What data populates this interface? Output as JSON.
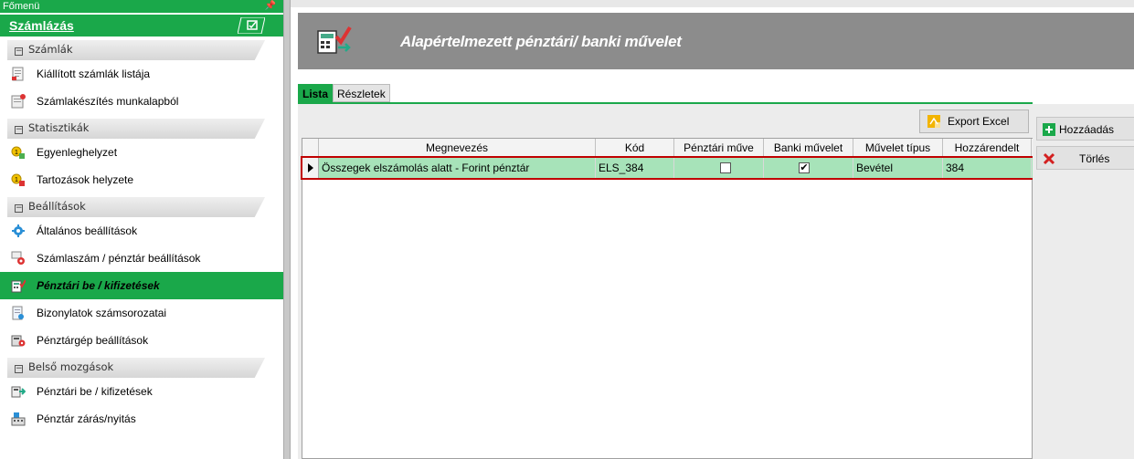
{
  "sidebar": {
    "title": "Főmenü",
    "pin": "ᵠ",
    "header": "Számlázás",
    "groups": {
      "szamlak": "Számlák",
      "statisztikak": "Statisztikák",
      "beallitasok": "Beállítások",
      "belso": "Belső mozgások"
    },
    "items": {
      "kiallitott": "Kiállított számlák listája",
      "munkalap": "Számlakészítés munkalapból",
      "egyenleg": "Egyenleghelyzet",
      "tartozasok": "Tartozások helyzete",
      "altalanos": "Általános beállítások",
      "szamlaszam": "Számlaszám / pénztár beállítások",
      "penztari": "Pénztári be / kifizetések",
      "bizonylatok": "Bizonylatok számsorozatai",
      "penztargep": "Pénztárgép beállítások",
      "penztari_belso": "Pénztári be / kifizetések",
      "zaras": "Pénztár zárás/nyitás"
    }
  },
  "banner": {
    "title": "Alapértelmezett pénztári/ banki művelet"
  },
  "tabs": {
    "lista": "Lista",
    "reszletek": "Részletek"
  },
  "toolbar": {
    "export": "Export Excel",
    "add": "Hozzáadás",
    "delete": "Törlés"
  },
  "grid": {
    "columns": [
      "Megnevezés",
      "Kód",
      "Pénztári műve",
      "Banki művelet",
      "Művelet típus",
      "Hozzárendelt"
    ],
    "rows": [
      {
        "megnevezes": "Összegek elszámolás alatt - Forint pénztár",
        "kod": "ELS_384",
        "penztari": false,
        "banki": true,
        "tipus": "Bevétel",
        "hozzarendelt": "384"
      }
    ]
  },
  "colors": {
    "accent": "#1aa84a",
    "banner": "#8c8c8c",
    "selected_row": "#a7e3b9",
    "highlight": "#c00000"
  }
}
